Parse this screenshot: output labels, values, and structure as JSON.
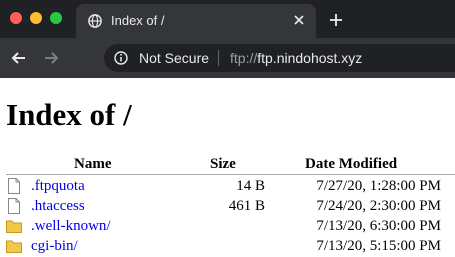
{
  "tab": {
    "title": "Index of /"
  },
  "toolbar": {
    "security_label": "Not Secure",
    "url_scheme": "ftp://",
    "url_host": "ftp.nindohost.xyz"
  },
  "page": {
    "title": "Index of /",
    "columns": {
      "name": "Name",
      "size": "Size",
      "date": "Date Modified"
    },
    "rows": [
      {
        "name": ".ftpquota",
        "size": "14 B",
        "date": "7/27/20, 1:28:00 PM",
        "icon": "file-icon"
      },
      {
        "name": ".htaccess",
        "size": "461 B",
        "date": "7/24/20, 2:30:00 PM",
        "icon": "file-icon"
      },
      {
        "name": ".well-known/",
        "size": "",
        "date": "7/13/20, 6:30:00 PM",
        "icon": "folder-icon"
      },
      {
        "name": "cgi-bin/",
        "size": "",
        "date": "7/13/20, 5:15:00 PM",
        "icon": "folder-icon"
      }
    ]
  },
  "colors": {
    "chrome_dark": "#202124",
    "chrome_tab": "#35363a",
    "link": "#0000ee",
    "folder": "#f1c84b"
  }
}
